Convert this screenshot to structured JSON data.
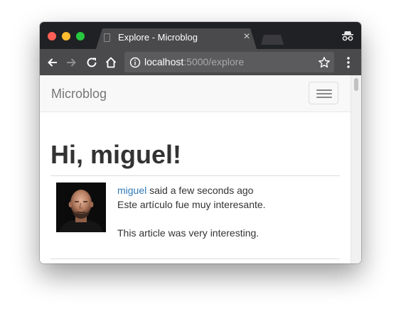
{
  "browser": {
    "tab": {
      "title": "Explore - Microblog",
      "close_glyph": "×"
    },
    "url": {
      "host": "localhost",
      "rest": ":5000/explore"
    },
    "icons": {
      "close": "close-icon",
      "minimize": "minimize-icon",
      "maximize": "maximize-icon",
      "incognito": "incognito-icon",
      "back": "back-arrow-icon",
      "forward": "forward-arrow-icon",
      "reload": "reload-icon",
      "home": "home-icon",
      "info": "info-icon",
      "bookmark": "star-icon",
      "menu": "kebab-menu-icon",
      "document": "document-icon"
    },
    "colors": {
      "close": "#fe5f57",
      "minimize": "#febc2e",
      "maximize": "#28c840",
      "tabstrip": "#202124",
      "toolbar": "#4a4a4c"
    }
  },
  "page": {
    "navbar": {
      "brand": "Microblog",
      "toggle_icon": "hamburger-icon"
    },
    "heading": "Hi, miguel!",
    "posts": [
      {
        "author": "miguel",
        "timestamp_text": " said a few seconds ago",
        "body_lines": [
          "Este artículo fue muy interesante.",
          "This article was very interesting."
        ]
      }
    ],
    "colors": {
      "link": "#337ab7",
      "text": "#333333",
      "navbar_bg": "#f8f8f8"
    }
  }
}
